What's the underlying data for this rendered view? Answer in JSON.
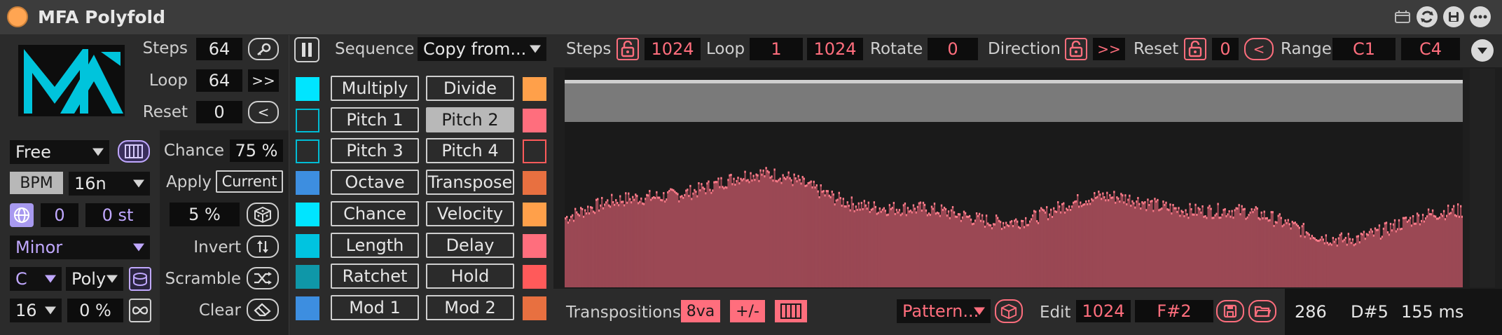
{
  "title_bar": {
    "title": "MFA Polyfold",
    "title_icons": [
      "window-icon",
      "refresh-icon",
      "save-icon",
      "more-icon"
    ]
  },
  "left_panel": {
    "steps_label": "Steps",
    "steps_value": "64",
    "loop_label": "Loop",
    "loop_value": "64",
    "loop_btn": ">>",
    "reset_label": "Reset",
    "reset_value": "0",
    "reset_btn": "<",
    "sync_mode": "Free",
    "bpm_label": "BPM",
    "rate": "16n",
    "offset_value": "0",
    "transpose_value": "0 st",
    "scale": "Minor",
    "root": "C",
    "poly_mode": "Poly",
    "voices": "16",
    "percent": "0 %"
  },
  "mod_panel": {
    "chance_label": "Chance",
    "chance_value": "75 %",
    "apply_label": "Apply",
    "apply_value": "Current",
    "amount_value": "5 %",
    "invert_label": "Invert",
    "scramble_label": "Scramble",
    "clear_label": "Clear"
  },
  "sequence": {
    "label": "Sequence",
    "copy_from": "Copy from...",
    "buttons_left": [
      "Multiply",
      "Pitch 1",
      "Pitch 3",
      "Octave",
      "Chance",
      "Length",
      "Ratchet",
      "Mod 1"
    ],
    "buttons_right": [
      "Divide",
      "Pitch 2",
      "Pitch 4",
      "Transpose",
      "Velocity",
      "Delay",
      "Hold",
      "Mod 2"
    ],
    "swatches_left": [
      "#00e5ff",
      "outline:#00bcd4",
      "outline:#00bcd4",
      "#3d8ee0",
      "#00e5ff",
      "#00c4e0",
      "#0f97a8",
      "#3d8ee0"
    ],
    "swatches_right": [
      "#ffa04a",
      "#ff6e7d",
      "outline:#ff5a5a",
      "#e87040",
      "#ffa04a",
      "#ff6e7d",
      "#ff5a5a",
      "#e87040"
    ],
    "selected": "Pitch 2"
  },
  "editor": {
    "steps_label": "Steps",
    "steps_value": "1024",
    "loop_label": "Loop",
    "loop_start": "1",
    "loop_end": "1024",
    "rotate_label": "Rotate",
    "rotate_value": "0",
    "direction_label": "Direction",
    "direction_value": ">>",
    "reset_label": "Reset",
    "reset_value": "0",
    "reset_btn": "<",
    "range_label": "Range",
    "range_low": "C1",
    "range_high": "C4"
  },
  "bottom_bar": {
    "transpositions_label": "Transpositions",
    "oct_btn": "8va",
    "plusminus_btn": "+/-",
    "pattern": "Pattern...",
    "edit_label": "Edit",
    "edit_step": "1024",
    "edit_note": "F#2",
    "status_value": "286",
    "status_note": "D#5",
    "status_time": "155 ms"
  },
  "colors": {
    "accent_pink": "#ff6e7d",
    "accent_purple": "#c0a8ff",
    "cyan": "#00e5ff",
    "bar_fill": "#9b4854",
    "bar_tip": "#ff7d8b"
  }
}
